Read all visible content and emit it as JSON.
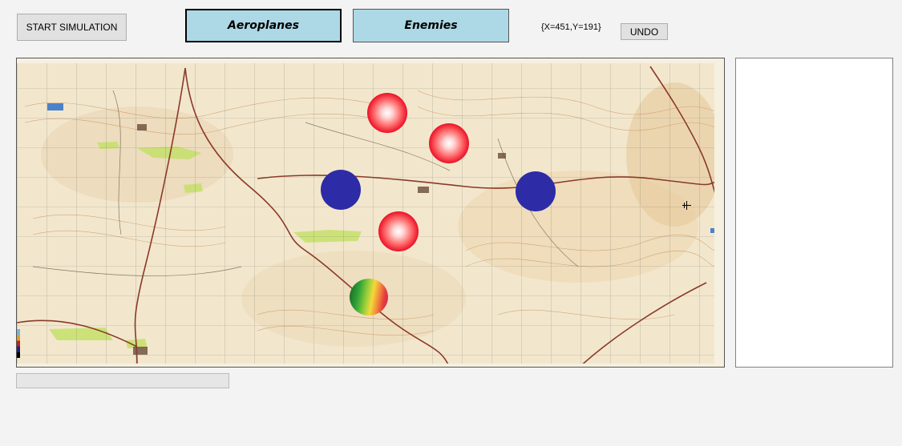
{
  "toolbar": {
    "start_label": "START SIMULATION",
    "aeroplanes_label": "Aeroplanes",
    "enemies_label": "Enemies",
    "coordinates": "{X=451,Y=191}",
    "undo_label": "UNDO"
  },
  "map": {
    "description_icon": "topographic-map",
    "enemies_count": 3,
    "aeroplanes_count": 2,
    "player_count": 1
  },
  "progress": {
    "value": 0
  },
  "colors": {
    "tab_background": "#add8e6",
    "enemy": "#e8001a",
    "aeroplane": "#2e2ba6",
    "road": "#8a3a2a"
  }
}
